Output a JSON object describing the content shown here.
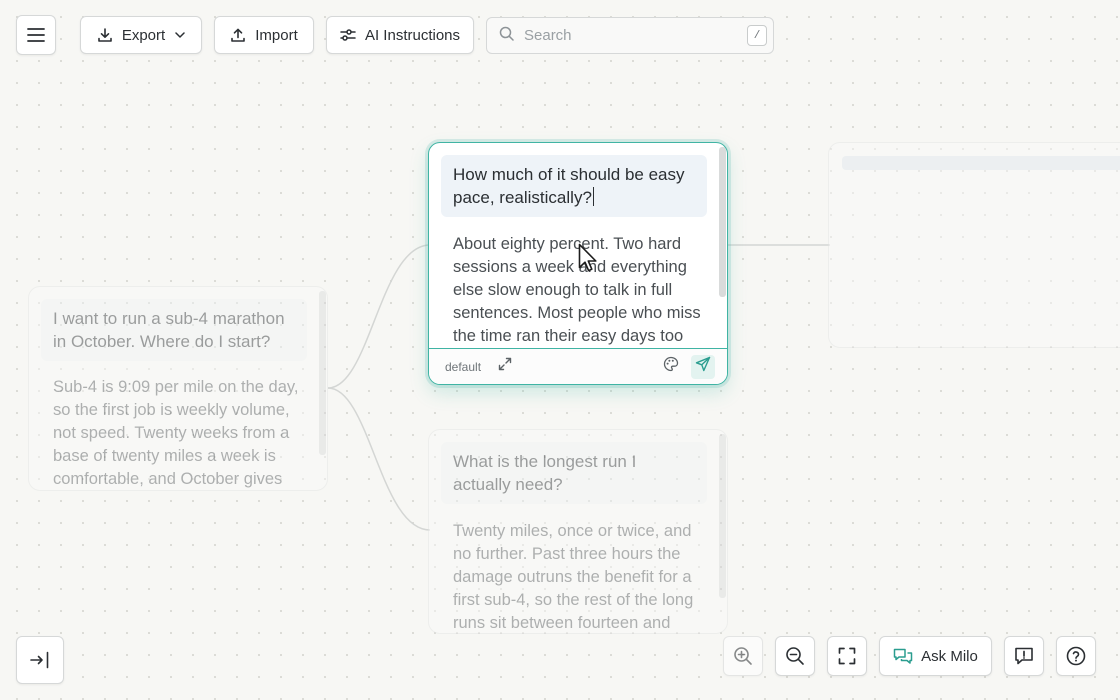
{
  "toolbar": {
    "export_label": "Export",
    "import_label": "Import",
    "ai_label": "AI Instructions",
    "search_placeholder": "Search",
    "search_value": "",
    "search_shortcut": "/"
  },
  "nodes": {
    "root": {
      "question": "I want to run a sub-4 marathon in October. Where do I start?",
      "answer": "Sub-4 is 9:09 per mile on the day, so the first job is weekly volume, not speed. Twenty weeks from a base of twenty miles a week is comfortable, and October gives"
    },
    "active": {
      "question": "How much of it should be easy pace, realistically?",
      "answer": "About eighty percent. Two hard sessions a week and everything else slow enough to talk in full sentences. Most people who miss the time ran their easy days too",
      "model_tag": "default"
    },
    "second": {
      "question": "What is the longest run I actually need?",
      "answer": "Twenty miles, once or twice, and no further. Past three hours the damage outruns the benefit for a first sub-4, so the rest of the long runs sit between fourteen and"
    }
  },
  "bottom": {
    "ask_label": "Ask Milo"
  },
  "colors": {
    "accent": "#40b4a4",
    "canvas": "#f7f7f4"
  }
}
